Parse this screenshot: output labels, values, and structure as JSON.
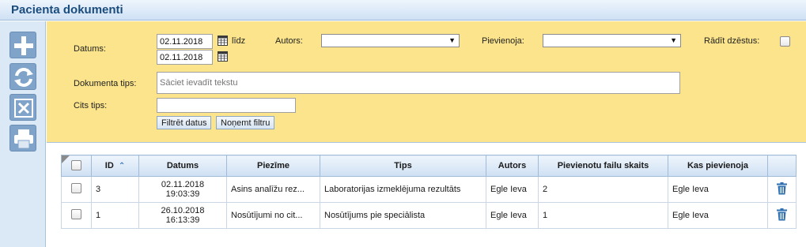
{
  "window": {
    "title": "Pacienta dokumenti"
  },
  "toolbar": {
    "add": {
      "icon": "plus-icon"
    },
    "refresh": {
      "icon": "refresh-icon"
    },
    "export": {
      "icon": "excel-icon"
    },
    "print": {
      "icon": "printer-icon"
    }
  },
  "filter": {
    "date_label": "Datums:",
    "date_from": "02.11.2018",
    "date_to": "02.11.2018",
    "until_label": "līdz",
    "author_label": "Autors:",
    "author_value": "",
    "added_by_label": "Pievienoja:",
    "added_by_value": "",
    "show_deleted_label": "Rādīt dzēstus:",
    "show_deleted": false,
    "doc_type_label": "Dokumenta tips:",
    "doc_type_placeholder": "Sāciet ievadīt tekstu",
    "other_type_label": "Cits tips:",
    "other_type_value": "",
    "apply_label": "Filtrēt datus",
    "clear_label": "Noņemt filtru"
  },
  "table": {
    "columns": [
      "",
      "ID",
      "Datums",
      "Piezīme",
      "Tips",
      "Autors",
      "Pievienotu failu skaits",
      "Kas pievienoja",
      ""
    ],
    "rows": [
      {
        "id": "3",
        "date": "02.11.2018",
        "time": "19:03:39",
        "note": "Asins analīžu rez...",
        "type": "Laboratorijas izmeklējuma rezultāts",
        "author": "Egle Ieva",
        "files": "2",
        "added_by": "Egle Ieva"
      },
      {
        "id": "1",
        "date": "26.10.2018",
        "time": "16:13:39",
        "note": "Nosūtījumi no cit...",
        "type": "Nosūtījums pie speciālista",
        "author": "Egle Ieva",
        "files": "1",
        "added_by": "Egle Ieva"
      }
    ]
  },
  "colors": {
    "title": "#1a4c7e",
    "filter_bg": "#fbe48b",
    "tool_bg": "#7fa3c9",
    "trash": "#2f6fb0"
  }
}
